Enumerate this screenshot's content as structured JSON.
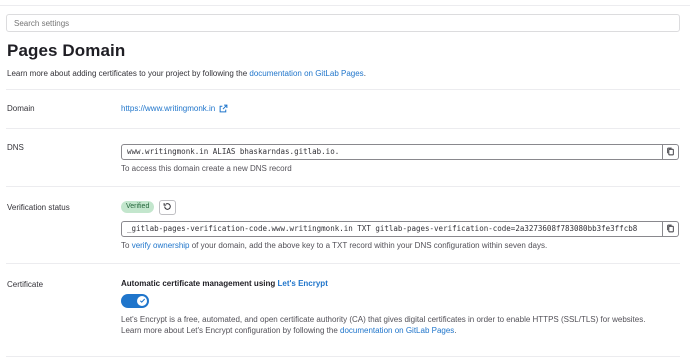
{
  "search": {
    "placeholder": "Search settings"
  },
  "page": {
    "title": "Pages Domain",
    "intro_text": "Learn more about adding certificates to your project by following the",
    "intro_link": "documentation on GitLab Pages",
    "intro_end": "."
  },
  "domain": {
    "label": "Domain",
    "url": "https://www.writingmonk.in",
    "icon": "external-link-icon"
  },
  "dns": {
    "label": "DNS",
    "record": "www.writingmonk.in ALIAS bhaskarndas.gitlab.io.",
    "help": "To access this domain create a new DNS record",
    "icon": "copy-icon"
  },
  "verification": {
    "label": "Verification status",
    "badge": "Verified",
    "badge_color": "#c3e6cd",
    "record": "_gitlab-pages-verification-code.www.writingmonk.in TXT gitlab-pages-verification-code=2a3273608f783080bb3fe3ffcb8",
    "help_before": "To",
    "help_link": "verify ownership",
    "help_after": "of your domain, add the above key to a TXT record within your DNS configuration within seven days.",
    "retry_icon": "retry-icon"
  },
  "certificate": {
    "label": "Certificate",
    "title_text": "Automatic certificate management using",
    "title_link": "Let's Encrypt",
    "toggle_on": true,
    "accent": "#1f75cb",
    "desc_line1": "Let's Encrypt is a free, automated, and open certificate authority (CA) that gives digital certificates in order to enable HTTPS (SSL/TLS) for websites.",
    "desc_line2_text": "Learn more about Let's Encrypt configuration by following the",
    "desc_line2_link": "documentation on GitLab Pages",
    "desc_line2_end": "."
  }
}
